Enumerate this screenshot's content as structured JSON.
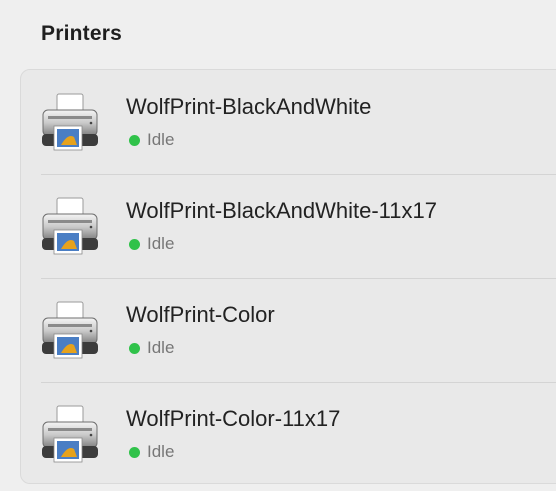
{
  "section": {
    "title": "Printers"
  },
  "colors": {
    "status_idle": "#30c24a",
    "background": "#efefef",
    "list_background": "#e9e9e9"
  },
  "printers": [
    {
      "name": "WolfPrint-BlackAndWhite",
      "status": "Idle",
      "icon": "printer-icon"
    },
    {
      "name": "WolfPrint-BlackAndWhite-11x17",
      "status": "Idle",
      "icon": "printer-icon"
    },
    {
      "name": "WolfPrint-Color",
      "status": "Idle",
      "icon": "printer-icon"
    },
    {
      "name": "WolfPrint-Color-11x17",
      "status": "Idle",
      "icon": "printer-icon"
    }
  ]
}
